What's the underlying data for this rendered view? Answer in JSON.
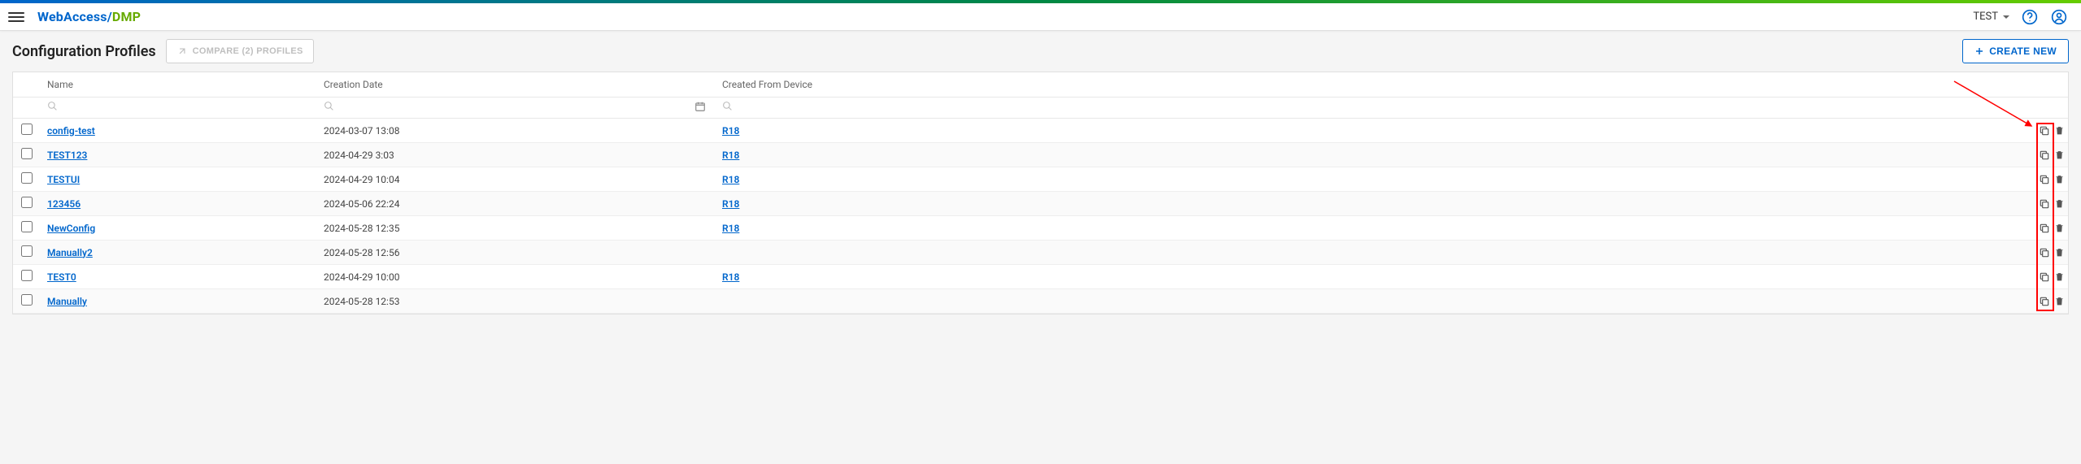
{
  "header": {
    "logo_wa": "WebAccess/",
    "logo_dmp": "DMP",
    "user": "TEST"
  },
  "page": {
    "title": "Configuration Profiles",
    "compare_label": "COMPARE (2) PROFILES",
    "create_label": "CREATE NEW"
  },
  "columns": {
    "name": "Name",
    "date": "Creation Date",
    "device": "Created From Device"
  },
  "rows": [
    {
      "name": "config-test",
      "date": "2024-03-07 13:08",
      "device": "R18"
    },
    {
      "name": "TEST123",
      "date": "2024-04-29 3:03",
      "device": "R18"
    },
    {
      "name": "TESTUI",
      "date": "2024-04-29 10:04",
      "device": "R18"
    },
    {
      "name": "123456",
      "date": "2024-05-06 22:24",
      "device": "R18"
    },
    {
      "name": "NewConfig",
      "date": "2024-05-28 12:35",
      "device": "R18"
    },
    {
      "name": "Manually2",
      "date": "2024-05-28 12:56",
      "device": ""
    },
    {
      "name": "TEST0",
      "date": "2024-04-29 10:00",
      "device": "R18"
    },
    {
      "name": "Manually",
      "date": "2024-05-28 12:53",
      "device": ""
    }
  ]
}
